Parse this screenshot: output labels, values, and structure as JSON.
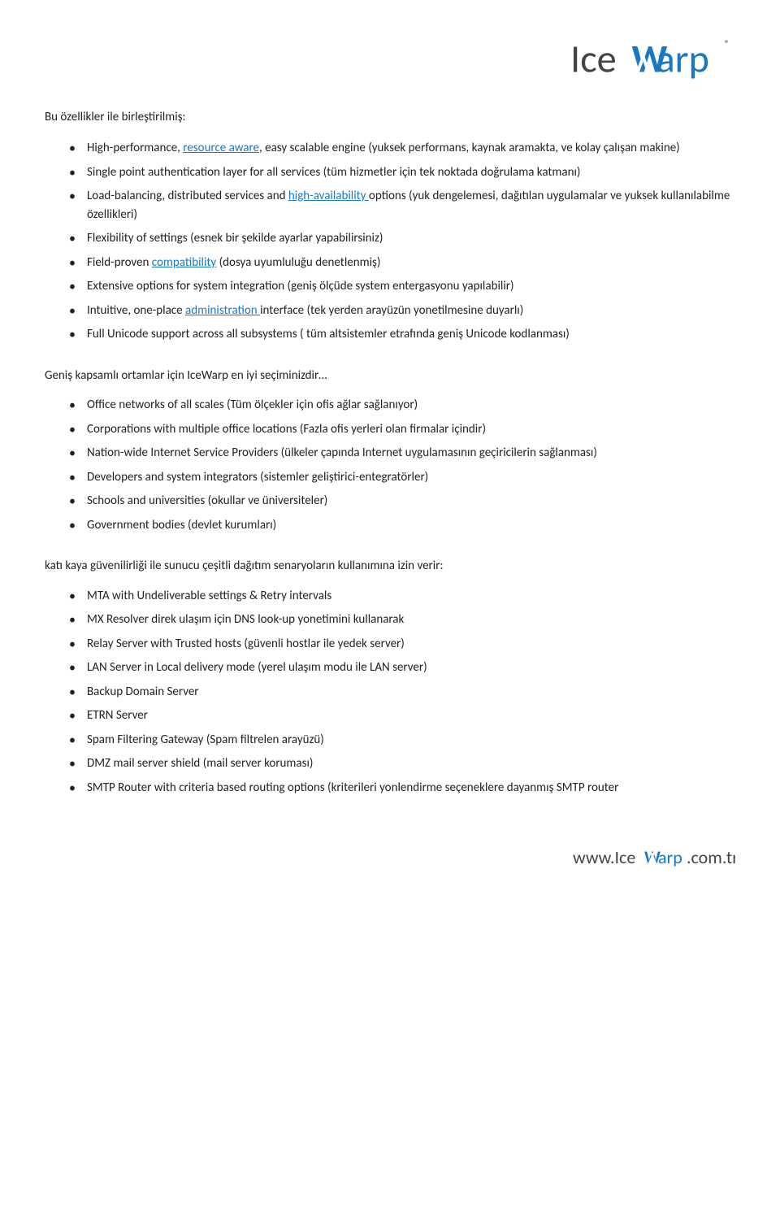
{
  "header": {
    "logo_alt": "IceWarp Logo"
  },
  "intro": {
    "heading": "Bu özellikler ile birleştirilmiş:"
  },
  "bullet_list_1": [
    {
      "text_before": "High-performance, ",
      "link_text": "resource aware",
      "text_after": ", easy scalable engine (yuksek performans, kaynak aramakta, ve kolay çalışan makine)"
    },
    {
      "text_before": "Single point authentication layer for all services (tüm hizmetler için tek noktada doğrulama katmanı)"
    },
    {
      "text_before": "Load-balancing, distributed services and ",
      "link_text": "high-availability ",
      "text_after": "options (yuk dengelemesi, dağıtılan uygulamalar ve yuksek kullanılabilme özellikleri)"
    },
    {
      "text_before": "Flexibility of settings (esnek bir şekilde ayarlar yapabilirsiniz)"
    },
    {
      "text_before": "Field-proven ",
      "link_text": "compatibility",
      "text_after": " (dosya uyumluluğu denetlenmiş)"
    },
    {
      "text_before": "Extensive options for system integration (geniş ölçüde system entergasyonu yapılabilir)"
    },
    {
      "text_before": "Intuitive, one-place ",
      "link_text": "administration ",
      "text_after": "interface (tek yerden arayüzün yonetilmesine duyarlı)"
    },
    {
      "text_before": "Full Unicode support across all subsystems ( tüm altsistemler etrafında geniş Unicode kodlanması)"
    }
  ],
  "section_2_heading": "Geniş kapsamlı ortamlar için IceWarp en iyi seçiminizdir…",
  "bullet_list_2": [
    "Office networks of all scales (Tüm ölçekler için ofis ağlar sağlanıyor)",
    "Corporations with multiple office locations (Fazla ofis yerleri olan firmalar içindir)",
    "Nation-wide Internet Service Providers (ülkeler çapında Internet uygulamasının geçiricilerin sağlanması)",
    "Developers and system integrators (sistemler geliştirici-entegratörler)",
    "Schools and universities (okullar ve üniversiteler)",
    "Government bodies (devlet kurumları)"
  ],
  "section_3_heading": "katı kaya güvenilirliği ile sunucu çeşitli dağıtım senaryoların kullanımına izin verir:",
  "bullet_list_3": [
    "MTA with Undeliverable settings & Retry intervals",
    "MX Resolver direk ulaşım için DNS look-up yonetimini kullanarak",
    "Relay Server with Trusted hosts (güvenli hostlar ile yedek server)",
    "LAN Server in Local delivery mode (yerel ulaşım modu ile LAN server)",
    "Backup Domain Server",
    "ETRN Server",
    "Spam Filtering Gateway (Spam filtrelen arayüzü)",
    "DMZ mail server shield (mail server koruması)",
    "SMTP Router with criteria based routing options (kriterileri yonlendirme seçeneklere dayanmış SMTP router"
  ],
  "footer": {
    "url_prefix": "www.Ice",
    "url_warp": "Warp",
    "url_suffix": ".com.tr"
  }
}
